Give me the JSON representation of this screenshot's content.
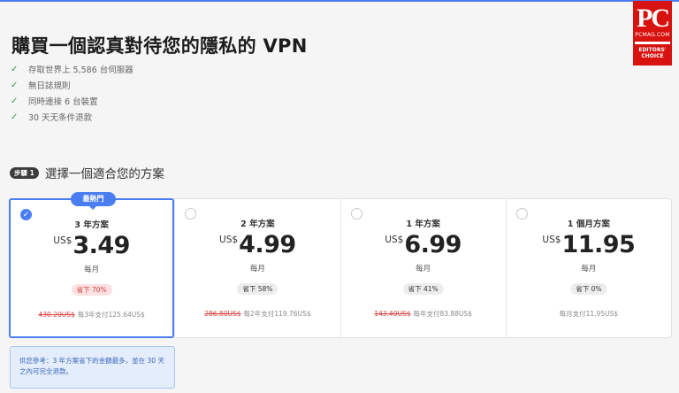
{
  "badge": {
    "brand": "PC",
    "site": "PCMAG.COM",
    "award_line1": "EDITORS'",
    "award_line2": "CHOICE"
  },
  "header": {
    "title": "購買一個認真對待您的隱私的 VPN"
  },
  "features": [
    {
      "icon": "check-icon",
      "text": "存取世界上 5,586 台伺服器"
    },
    {
      "icon": "check-icon",
      "text": "無日誌規則"
    },
    {
      "icon": "check-icon",
      "text": "同時連接 6 台裝置"
    },
    {
      "icon": "check-icon",
      "text": "30 天无条件退款"
    }
  ],
  "step": {
    "badge": "步驟 1",
    "text": "選擇一個適合您的方案"
  },
  "popular_label": "最熱門",
  "plans": [
    {
      "name": "3 年方案",
      "currency": "US$",
      "amount": "3.49",
      "period": "每月",
      "save": "省下 70%",
      "original": "430.20US$",
      "billing": "每3年支付125.64US$",
      "selected": true,
      "check": "✓"
    },
    {
      "name": "2 年方案",
      "currency": "US$",
      "amount": "4.99",
      "period": "每月",
      "save": "省下 58%",
      "original": "286.80US$",
      "billing": "每2年支付119.76US$",
      "selected": false
    },
    {
      "name": "1 年方案",
      "currency": "US$",
      "amount": "6.99",
      "period": "每月",
      "save": "省下 41%",
      "original": "143.40US$",
      "billing": "每年支付83.88US$",
      "selected": false
    },
    {
      "name": "1 個月方案",
      "currency": "US$",
      "amount": "11.95",
      "period": "每月",
      "save": "省下 0%",
      "original": "",
      "billing": "每月支付11.95US$",
      "selected": false
    }
  ],
  "note": {
    "text": "供您參考：3 年方案省下的金額最多，並在 30 天之內可完全退款。"
  },
  "colors": {
    "accent": "#4a7ef0",
    "brand_red": "#d8120e",
    "check_green": "#2e9e4a",
    "discount_red": "#d33b3b"
  }
}
